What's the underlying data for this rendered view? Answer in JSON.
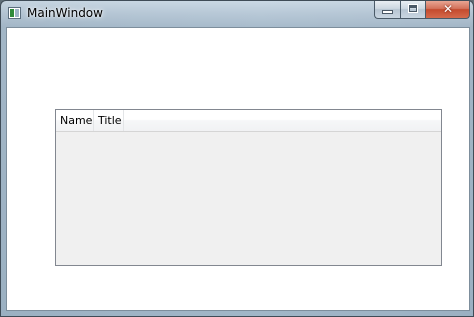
{
  "window": {
    "title": "MainWindow",
    "caption_buttons": {
      "minimize_icon": "minimize-icon",
      "maximize_icon": "maximize-icon",
      "close_icon": "close-icon",
      "close_glyph": "✕"
    }
  },
  "list_view": {
    "columns": [
      {
        "label": "Name"
      },
      {
        "label": "Title"
      }
    ],
    "rows": []
  },
  "colors": {
    "close_button": "#c44a2e",
    "list_background": "#f0f0f0",
    "list_border": "#828790",
    "client_background": "#ffffff"
  }
}
